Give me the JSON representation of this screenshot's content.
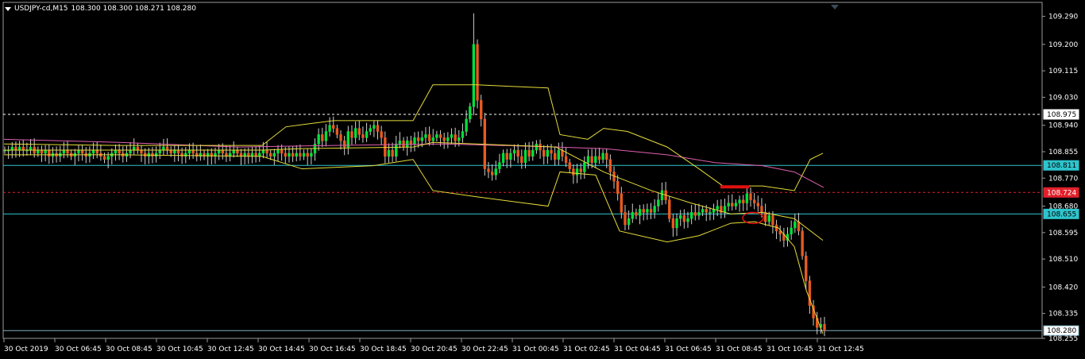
{
  "header": {
    "symbol": "USDJPY-cd,M15",
    "quote": "108.300 108.300 108.271 108.280"
  },
  "chart_data": {
    "type": "candlestick",
    "symbol": "USDJPY-cd",
    "timeframe": "M15",
    "ohlc_last": {
      "open": 108.3,
      "high": 108.3,
      "low": 108.271,
      "close": 108.28
    },
    "y_range": [
      108.255,
      109.335
    ],
    "y_ticks": [
      "109.290",
      "109.200",
      "109.115",
      "109.030",
      "108.940",
      "108.855",
      "108.770",
      "108.680",
      "108.595",
      "108.510",
      "108.420",
      "108.335",
      "108.255"
    ],
    "x_ticks": [
      "30 Oct 2019",
      "30 Oct 06:45",
      "30 Oct 08:45",
      "30 Oct 10:45",
      "30 Oct 12:45",
      "30 Oct 14:45",
      "30 Oct 16:45",
      "30 Oct 18:45",
      "30 Oct 20:45",
      "30 Oct 22:45",
      "31 Oct 00:45",
      "31 Oct 02:45",
      "31 Oct 04:45",
      "31 Oct 06:45",
      "31 Oct 08:45",
      "31 Oct 10:45",
      "31 Oct 12:45"
    ],
    "levels": [
      {
        "price": 108.975,
        "label": "108.975",
        "style": "dashed",
        "color": "#ffffff"
      },
      {
        "price": 108.811,
        "label": "108.811",
        "style": "solid",
        "color": "#2ec4cc"
      },
      {
        "price": 108.724,
        "label": "108.724",
        "style": "dashed",
        "color": "#e0202a"
      },
      {
        "price": 108.655,
        "label": "108.655",
        "style": "solid",
        "color": "#2ec4cc"
      },
      {
        "price": 108.28,
        "label": "108.280",
        "style": "solid",
        "color": "#7fb0c0"
      }
    ],
    "candle_colors": {
      "bull": "#00e23a",
      "bear": "#e85a20",
      "wick": "#d0d0d0"
    },
    "ma_color": "#e060b0",
    "band_color": "#e6dc3a",
    "grid": false,
    "annotations": [
      "red horizontal mark near 108.74",
      "red ellipse near 108.64 at 31 Oct 08:45-09:15"
    ]
  }
}
